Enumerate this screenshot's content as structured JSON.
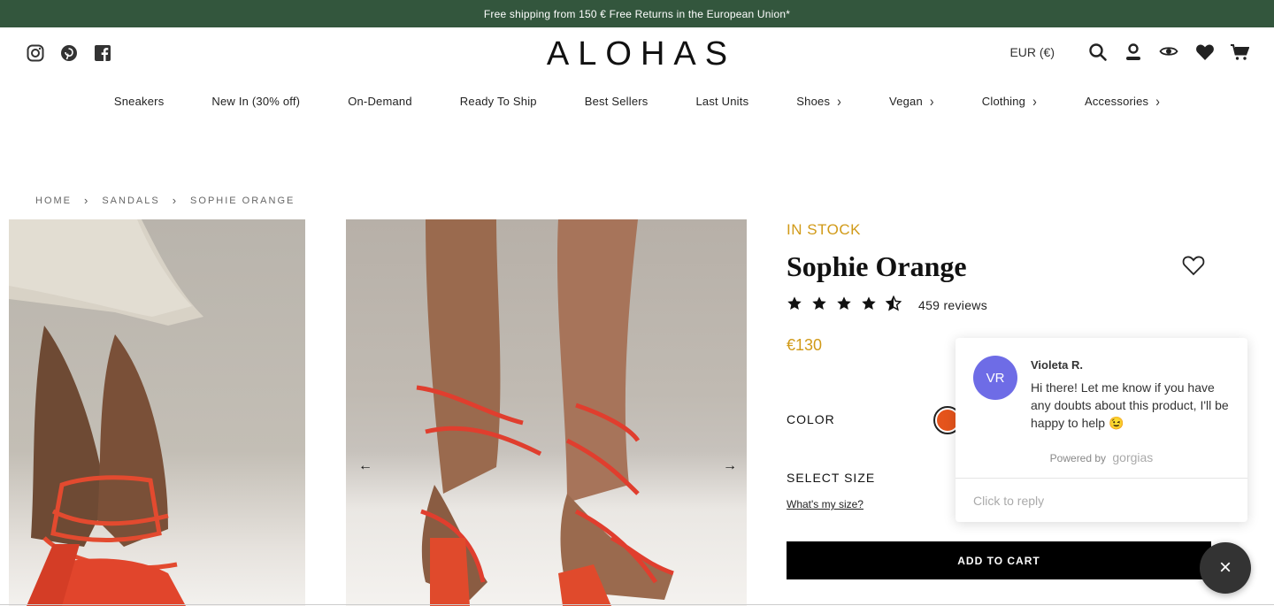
{
  "announcement": "Free shipping from 150 € Free Returns in the European Union*",
  "brand": "ALOHAS",
  "social_icons": [
    "instagram-icon",
    "pinterest-icon",
    "facebook-icon"
  ],
  "currency": "EUR  (€)",
  "header_icons": [
    "search-icon",
    "account-icon",
    "eye-icon",
    "heart-icon",
    "cart-icon"
  ],
  "nav": [
    {
      "label": "Sneakers",
      "has_children": false
    },
    {
      "label": "New In (30% off)",
      "has_children": false
    },
    {
      "label": "On-Demand",
      "has_children": false
    },
    {
      "label": "Ready To Ship",
      "has_children": false
    },
    {
      "label": "Best Sellers",
      "has_children": false
    },
    {
      "label": "Last Units",
      "has_children": false
    },
    {
      "label": "Shoes",
      "has_children": true
    },
    {
      "label": "Vegan",
      "has_children": true
    },
    {
      "label": "Clothing",
      "has_children": true
    },
    {
      "label": "Accessories",
      "has_children": true
    }
  ],
  "breadcrumb": [
    "HOME",
    "SANDALS",
    "SOPHIE ORANGE"
  ],
  "product": {
    "stock": "IN STOCK",
    "title": "Sophie Orange",
    "rating": 4.5,
    "reviews": "459 reviews",
    "price": "€130",
    "color_label": "COLOR",
    "selected_color": "#e5541c",
    "size_label": "SELECT SIZE",
    "size_link": "What's my size?",
    "add_to_cart": "ADD TO CART"
  },
  "gallery": {
    "prev": "←",
    "next": "→"
  },
  "chat": {
    "initials": "VR",
    "agent": "Violeta R.",
    "message": "Hi there! Let me know if you have any doubts about this product, I'll be happy to help 😉",
    "powered_prefix": "Powered by",
    "powered_brand": "gorgias",
    "reply_placeholder": "Click to reply",
    "close": "×"
  },
  "colors": {
    "announce_bg": "#33563d",
    "accent": "#d19a18",
    "chat_avatar": "#6e6ce6"
  }
}
